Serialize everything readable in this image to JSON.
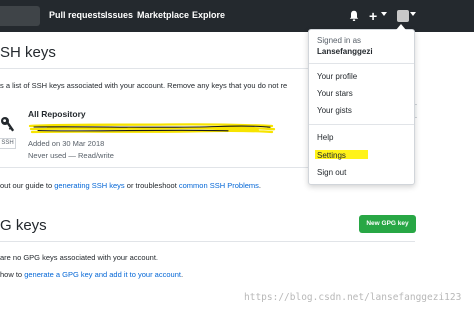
{
  "header": {
    "nav": {
      "pull_requests": "Pull requests",
      "issues": "Issues",
      "marketplace": "Marketplace",
      "explore": "Explore"
    },
    "icons": {
      "notifications": "bell-icon",
      "create": "plus-icon",
      "avatar": "avatar"
    }
  },
  "ssh_section": {
    "title": "SH keys",
    "description": "s a list of SSH keys associated with your account. Remove any keys that you do not re",
    "key": {
      "title": "All Repository",
      "badge": "SSH",
      "added": "Added on 30 Mar 2018",
      "usage": "Never used — Read/write"
    },
    "guide_prefix": "out our guide to ",
    "guide_link": "generating SSH keys",
    "guide_middle": " or troubleshoot ",
    "guide_link2": "common SSH Problems",
    "guide_suffix": "."
  },
  "gpg_section": {
    "title": "G keys",
    "new_button": "New GPG key",
    "empty_text": "are no GPG keys associated with your account.",
    "howto_prefix": "how to ",
    "howto_link": "generate a GPG key and add it to your account",
    "howto_suffix": "."
  },
  "dropdown": {
    "signed_in_label": "Signed in as",
    "username": "Lansefanggezi",
    "items": [
      {
        "label": "Your profile"
      },
      {
        "label": "Your stars"
      },
      {
        "label": "Your gists"
      },
      {
        "label": "Help"
      },
      {
        "label": "Settings"
      },
      {
        "label": "Sign out"
      }
    ]
  },
  "watermark": "https://blog.csdn.net/lansefanggezi123",
  "colors": {
    "header_bg": "#24292e",
    "link": "#0366d6",
    "green_button": "#28a745",
    "annotation_highlight": "#fff200",
    "annotation_scribble": "#f7e400"
  }
}
